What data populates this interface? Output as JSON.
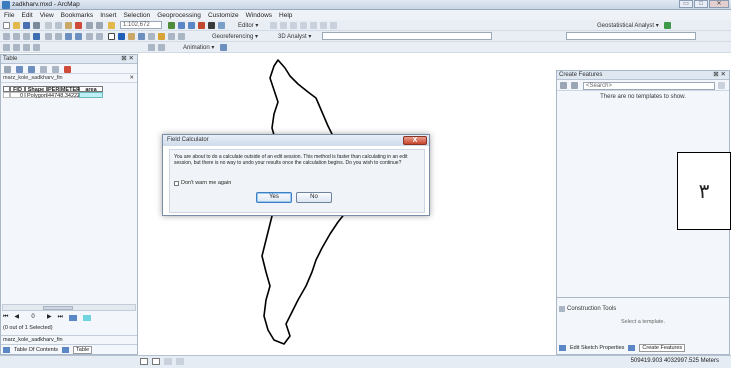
{
  "window": {
    "title": "zadkharv.mxd - ArcMap",
    "min": "▭",
    "max": "□",
    "close": "✕"
  },
  "menu": [
    "File",
    "Edit",
    "View",
    "Bookmarks",
    "Insert",
    "Selection",
    "Geoprocessing",
    "Customize",
    "Windows",
    "Help"
  ],
  "toolbar": {
    "scale": "1:102,672",
    "editor": "Editor ▾",
    "georef": "Georeferencing ▾",
    "analyst3d": "3D Analyst ▾",
    "geostat": "Geostatistical Analyst ▾",
    "animation": "Animation ▾"
  },
  "table_panel": {
    "header": "Table",
    "layer_tab": "marz_kole_sadkharv_fin",
    "columns": [
      "FID",
      "Shape",
      "PERIMETER",
      "area"
    ],
    "rows": [
      [
        "0",
        "Polygon",
        "44748.342225",
        ""
      ]
    ],
    "nav_record": "0",
    "selection_info": "(0 out of 1 Selected)",
    "layer_footer": "marz_kole_sadkharv_fin",
    "tabs": [
      "Table Of Contents",
      "Table"
    ]
  },
  "dialog": {
    "title": "Field Calculator",
    "message": "You are about to do a calculate outside of an edit session. This method is faster than calculating in an edit session, but there is no way to undo your results once the calculation begins. Do you wish to continue?",
    "checkbox": "Don't warn me again",
    "yes": "Yes",
    "no": "No",
    "close": "X"
  },
  "create_features": {
    "header": "Create Features",
    "search_placeholder": "<Search>",
    "empty": "There are no templates to show.",
    "construction_header": "Construction Tools",
    "construction_empty": "Select a template.",
    "edit_props": "Edit Sketch Properties",
    "create_btn": "Create Features"
  },
  "side_label": "۳",
  "status": {
    "coords": "509419.903  4032997.525 Meters"
  },
  "colors": {
    "accent": "#3c7fc4",
    "dialog_close": "#c8452c"
  }
}
